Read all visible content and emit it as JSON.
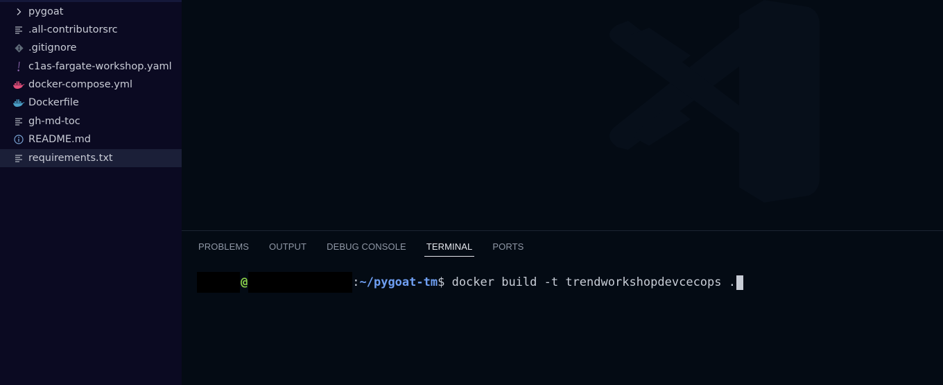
{
  "explorer": {
    "items": [
      {
        "label": "pygoat",
        "icon": "chevron-right-icon",
        "icon_color": "#c9ccd6"
      },
      {
        "label": ".all-contributorsrc",
        "icon": "lines-icon",
        "icon_color": "#a9adb8"
      },
      {
        "label": ".gitignore",
        "icon": "git-icon",
        "icon_color": "#5f6b78"
      },
      {
        "label": "c1as-fargate-workshop.yaml",
        "icon": "exclamation-icon",
        "icon_color": "#a074c4"
      },
      {
        "label": "docker-compose.yml",
        "icon": "docker-icon",
        "icon_color": "#e04e79"
      },
      {
        "label": "Dockerfile",
        "icon": "docker-icon",
        "icon_color": "#4a9ec6"
      },
      {
        "label": "gh-md-toc",
        "icon": "lines-icon",
        "icon_color": "#a9adb8"
      },
      {
        "label": "README.md",
        "icon": "info-icon",
        "icon_color": "#7aa5d6"
      },
      {
        "label": "requirements.txt",
        "icon": "lines-icon",
        "icon_color": "#a9adb8"
      }
    ],
    "selected": "requirements.txt"
  },
  "panel": {
    "tabs": [
      "PROBLEMS",
      "OUTPUT",
      "DEBUG CONSOLE",
      "TERMINAL",
      "PORTS"
    ],
    "active_tab": "TERMINAL"
  },
  "terminal": {
    "at": "@",
    "colon": ":",
    "path": "~/pygoat-tm",
    "dollar": "$ ",
    "command": "docker build -t trendworkshopdevcecops ."
  },
  "colors": {
    "sidebar_bg": "#0b0a22",
    "editor_bg": "#040b14",
    "selected_bg": "#1b1f38",
    "prompt_user": "#8bd24a",
    "prompt_path": "#6f9ff2"
  }
}
